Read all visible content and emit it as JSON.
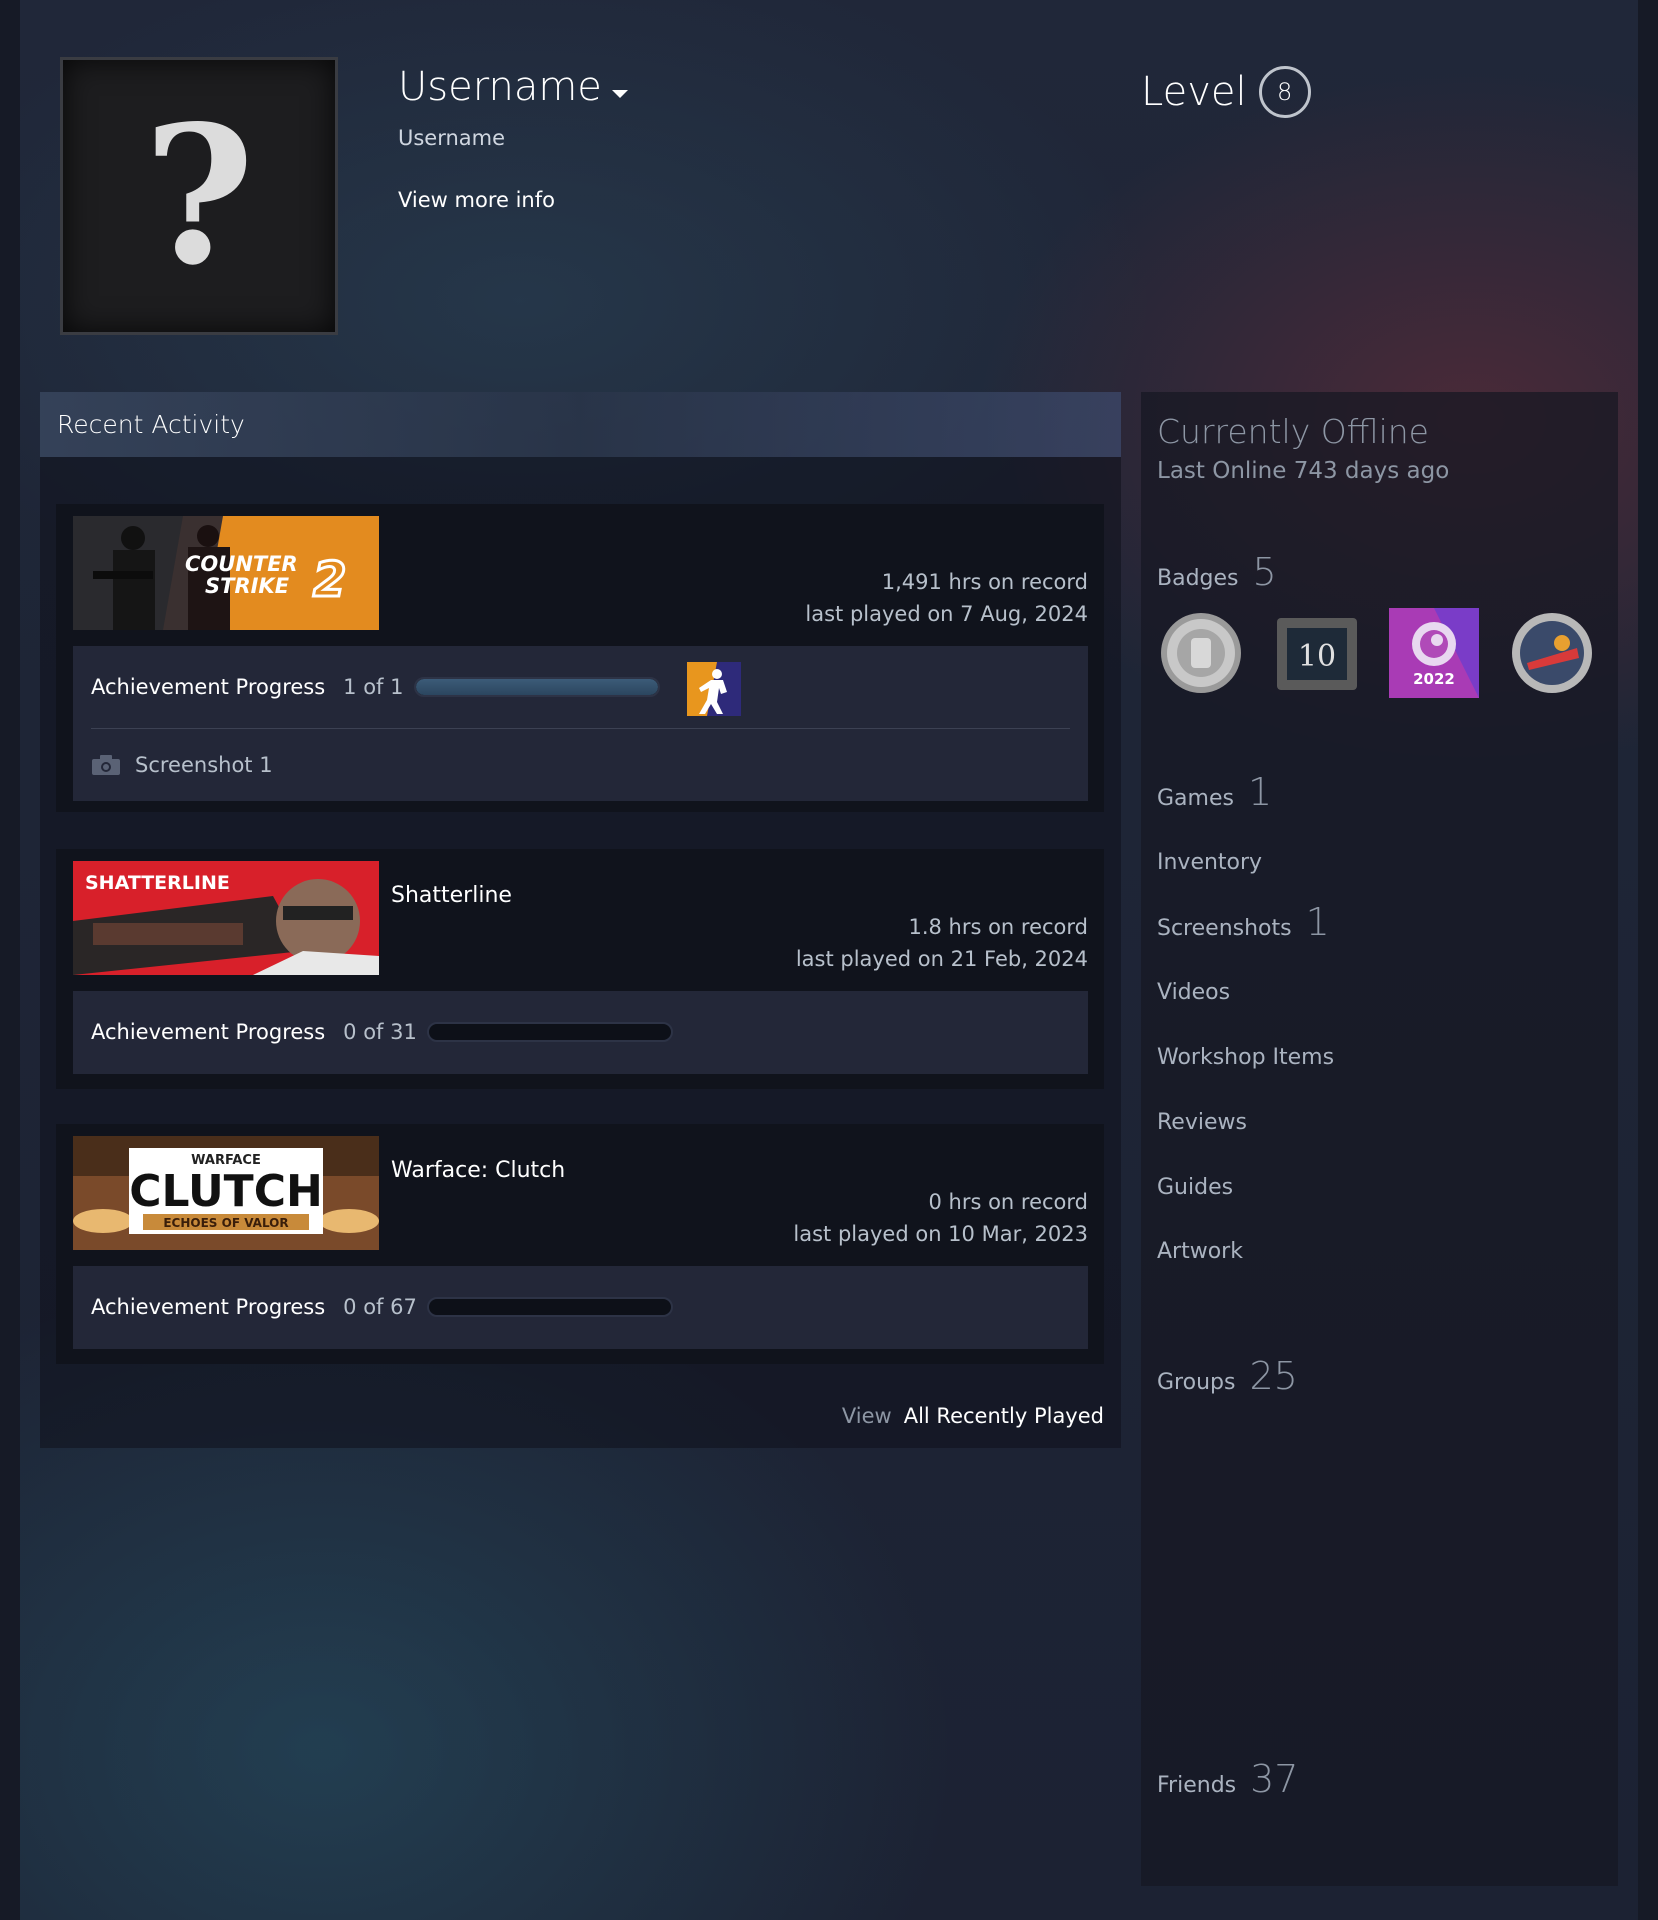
{
  "profile": {
    "persona_name": "Username",
    "real_name": "Username",
    "more_info": "View more info",
    "level_label": "Level",
    "level": "8"
  },
  "recent": {
    "title": "Recent Activity",
    "games": [
      {
        "name": "",
        "hours": "1,491 hrs on record",
        "last_played": "last played on 7 Aug, 2024",
        "ach_label": "Achievement Progress",
        "ach_count": "1 of 1",
        "ach_progress": 1.0,
        "screenshot": "Screenshot 1"
      },
      {
        "name": "Shatterline",
        "hours": "1.8 hrs on record",
        "last_played": "last played on 21 Feb, 2024",
        "ach_label": "Achievement Progress",
        "ach_count": "0 of 31",
        "ach_progress": 0
      },
      {
        "name": "Warface: Clutch",
        "hours": "0 hrs on record",
        "last_played": "last played on 10 Mar, 2023",
        "ach_label": "Achievement Progress",
        "ach_count": "0 of 67",
        "ach_progress": 0
      }
    ],
    "view_label": "View",
    "view_all": "All Recently Played"
  },
  "side": {
    "status": "Currently Offline",
    "last_online": "Last Online 743 days ago",
    "badges_label": "Badges",
    "badges_count": "5",
    "badge_2_text": "10",
    "badge_3_text": "2022",
    "games_label": "Games",
    "games_count": "1",
    "inventory": "Inventory",
    "screenshots_label": "Screenshots",
    "screenshots_count": "1",
    "videos": "Videos",
    "workshop": "Workshop Items",
    "reviews": "Reviews",
    "guides": "Guides",
    "artwork": "Artwork",
    "groups_label": "Groups",
    "groups_count": "25",
    "friends_label": "Friends",
    "friends_count": "37"
  },
  "capsule_text": {
    "cs2_line1": "COUNTER",
    "cs2_line2": "STRIKE",
    "shatterline": "SHATTERLINE",
    "warface_top": "WARFACE",
    "warface_main": "CLUTCH",
    "warface_sub": "ECHOES OF VALOR"
  },
  "colors": {
    "accent_white": "#ffffff",
    "muted": "#8d96a4",
    "panel": "#10131c",
    "achievement_box": "#232738"
  }
}
